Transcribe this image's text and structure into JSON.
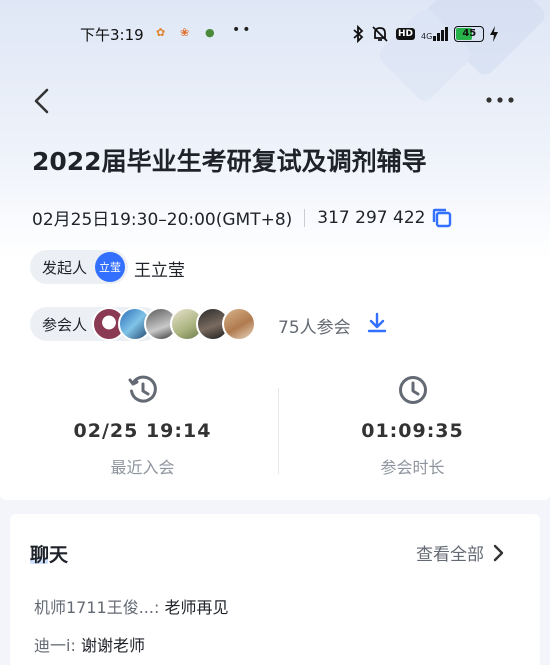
{
  "status": {
    "time": "下午3:19",
    "network": "4G",
    "hd": "HD",
    "battery": "45",
    "dots": "••"
  },
  "meeting": {
    "title": "2022届毕业生考研复试及调剂辅导",
    "datetime": "02月25日19:30–20:00(GMT+8)",
    "meeting_id": "317 297 422"
  },
  "host": {
    "label": "发起人",
    "avatar_text": "立莹",
    "name": "王立莹"
  },
  "attendees": {
    "label": "参会人",
    "count_text": "75人参会"
  },
  "stats": [
    {
      "value": "02/25 19:14",
      "label": "最近入会"
    },
    {
      "value": "01:09:35",
      "label": "参会时长"
    }
  ],
  "chat": {
    "title": "聊天",
    "see_all": "查看全部",
    "messages": [
      {
        "sender": "机师1711王俊...:",
        "text": "老师再见"
      },
      {
        "sender": "迪一i:",
        "text": "谢谢老师"
      }
    ]
  },
  "colors": {
    "accent": "#3370ff",
    "battery": "#27b24a"
  }
}
